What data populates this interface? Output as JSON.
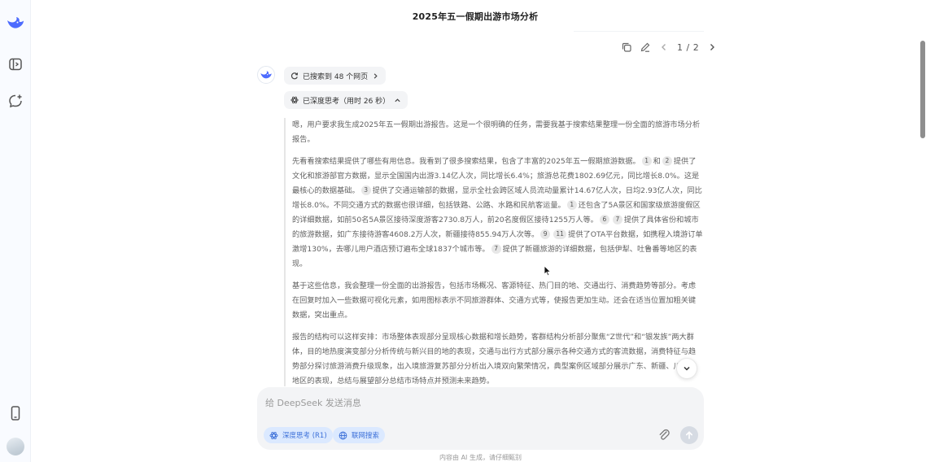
{
  "title": "2025年五一假期出游市场分析",
  "toolbar": {
    "pager": "1 / 2"
  },
  "search_pill": {
    "label": "已搜索到 48 个网页"
  },
  "think_pill": {
    "label": "已深度思考（用时 26 秒）"
  },
  "reasoning": {
    "p1": "嗯，用户要求我生成2025年五一假期出游报告。这是一个很明确的任务，需要我基于搜索结果整理一份全面的旅游市场分析报告。",
    "p2": {
      "s1": "先看看搜索结果提供了哪些有用信息。我看到了很多搜索结果，包含了丰富的2025年五一假期旅游数据。",
      "c1": "1",
      "s2": "和",
      "c2": "2",
      "s3": "提供了文化和旅游部官方数据，显示全国国内出游3.14亿人次，同比增长6.4%；旅游总花费1802.69亿元，同比增长8.0%。这是最核心的数据基础。",
      "c3": "3",
      "s4": "提供了交通运输部的数据，显示全社会跨区域人员流动量累计14.67亿人次，日均2.93亿人次，同比增长8.0%。不同交通方式的数据也很详细，包括铁路、公路、水路和民航客运量。",
      "c4": "1",
      "s5": "还包含了5A景区和国家级旅游度假区的详细数据，如前50名5A景区接待深度游客2730.8万人，前20名度假区接待1255万人等。",
      "c5": "6",
      "c6": "7",
      "s6": "提供了具体省份和城市的旅游数据，如广东接待游客4608.2万人次，新疆接待855.94万人次等。",
      "c7": "9",
      "c8": "11",
      "s7": "提供了OTA平台数据，如携程入境游订单激增130%，去哪儿用户酒店预订遍布全球1837个城市等。",
      "c9": "7",
      "s8": "提供了新疆旅游的详细数据，包括伊犁、吐鲁番等地区的表现。"
    },
    "p3": "基于这些信息，我会整理一份全面的出游报告，包括市场概况、客源特征、热门目的地、交通出行、消费趋势等部分。考虑在回复时加入一些数据可视化元素，如用图标表示不同旅游群体、交通方式等，使报告更加生动。还会在适当位置加粗关键数据，突出重点。",
    "p4": "报告的结构可以这样安排：市场整体表现部分呈现核心数据和增长趋势，客群结构分析部分聚焦“Z世代”和“银发族”两大群体，目的地热度演变部分分析传统与新兴目的地的表现，交通与出行方式部分展示各种交通方式的客流数据，消费特征与趋势部分探讨旅游消费升级现象，出入境旅游复苏部分分析出入境双向繁荣情况，典型案例区域部分展示广东、新疆、川渝等地区的表现，总结与展望部分总结市场特点并预测未来趋势。"
  },
  "composer": {
    "placeholder": "给 DeepSeek 发送消息",
    "deep_think": "深度思考 (R1)",
    "web_search": "联网搜索"
  },
  "disclaimer": "内容由 AI 生成，请仔细甄别",
  "colors": {
    "accent": "#4d6bfe",
    "chip_bg": "#dbe9ff",
    "chip_text": "#3b6fd8"
  }
}
